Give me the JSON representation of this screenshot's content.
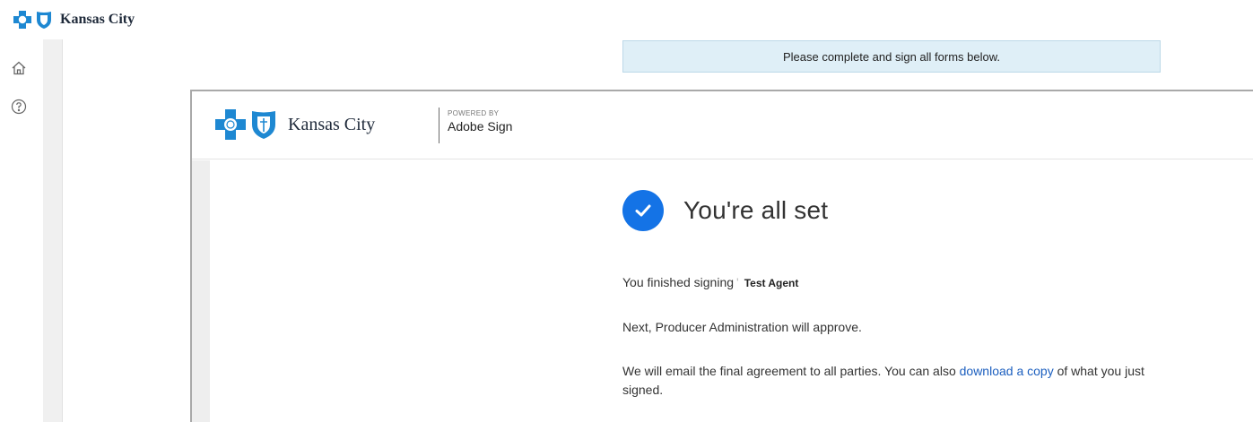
{
  "brand": {
    "name": "Kansas City",
    "cross_color": "#1e88d2",
    "shield_color": "#1e88d2"
  },
  "nav": {
    "home_icon": "home-icon",
    "help_icon": "help-circle-icon"
  },
  "banner": {
    "text": "Please complete and sign all forms below."
  },
  "frame": {
    "brand_name": "Kansas City",
    "powered_by": "POWERED BY",
    "product": "Adobe Sign"
  },
  "confirmation": {
    "title": "You're all set",
    "finished_prefix": "You finished signing",
    "document_name": "Test Agent",
    "next_step": "Next, Producer Administration will approve.",
    "email_text_before": "We will email the final agreement to all parties. You can also",
    "download_link": "download a copy",
    "email_text_after": "of what you just signed.",
    "accent_color": "#1473e6"
  }
}
